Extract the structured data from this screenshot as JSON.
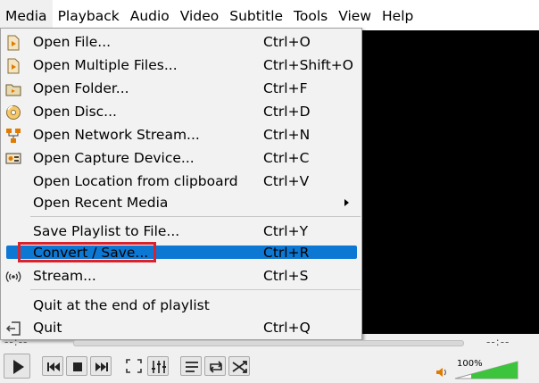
{
  "menubar": {
    "items": [
      "Media",
      "Playback",
      "Audio",
      "Video",
      "Subtitle",
      "Tools",
      "View",
      "Help"
    ]
  },
  "menu": {
    "items": [
      {
        "label": "Open File...",
        "shortcut": "Ctrl+O",
        "icon": "open-file-icon"
      },
      {
        "label": "Open Multiple Files...",
        "shortcut": "Ctrl+Shift+O",
        "icon": "open-multiple-files-icon"
      },
      {
        "label": "Open Folder...",
        "shortcut": "Ctrl+F",
        "icon": "folder-icon"
      },
      {
        "label": "Open Disc...",
        "shortcut": "Ctrl+D",
        "icon": "disc-icon"
      },
      {
        "label": "Open Network Stream...",
        "shortcut": "Ctrl+N",
        "icon": "network-icon"
      },
      {
        "label": "Open Capture Device...",
        "shortcut": "Ctrl+C",
        "icon": "capture-device-icon"
      },
      {
        "label": "Open Location from clipboard",
        "shortcut": "Ctrl+V",
        "icon": ""
      },
      {
        "label": "Open Recent Media",
        "shortcut": "",
        "icon": ""
      },
      {
        "label": "Save Playlist to File...",
        "shortcut": "Ctrl+Y",
        "icon": ""
      },
      {
        "label": "Convert / Save...",
        "shortcut": "Ctrl+R",
        "icon": ""
      },
      {
        "label": "Stream...",
        "shortcut": "Ctrl+S",
        "icon": "stream-icon"
      },
      {
        "label": "Quit at the end of playlist",
        "shortcut": "",
        "icon": ""
      },
      {
        "label": "Quit",
        "shortcut": "Ctrl+Q",
        "icon": "quit-icon"
      }
    ]
  },
  "seek": {
    "elapsed": "--:--",
    "remaining": "--:--"
  },
  "volume": {
    "label": "100%",
    "level": 1.0
  },
  "colors": {
    "highlight": "#0d78d4",
    "annotation_box": "#d9222c",
    "volume_fill": "#3cc43c"
  }
}
